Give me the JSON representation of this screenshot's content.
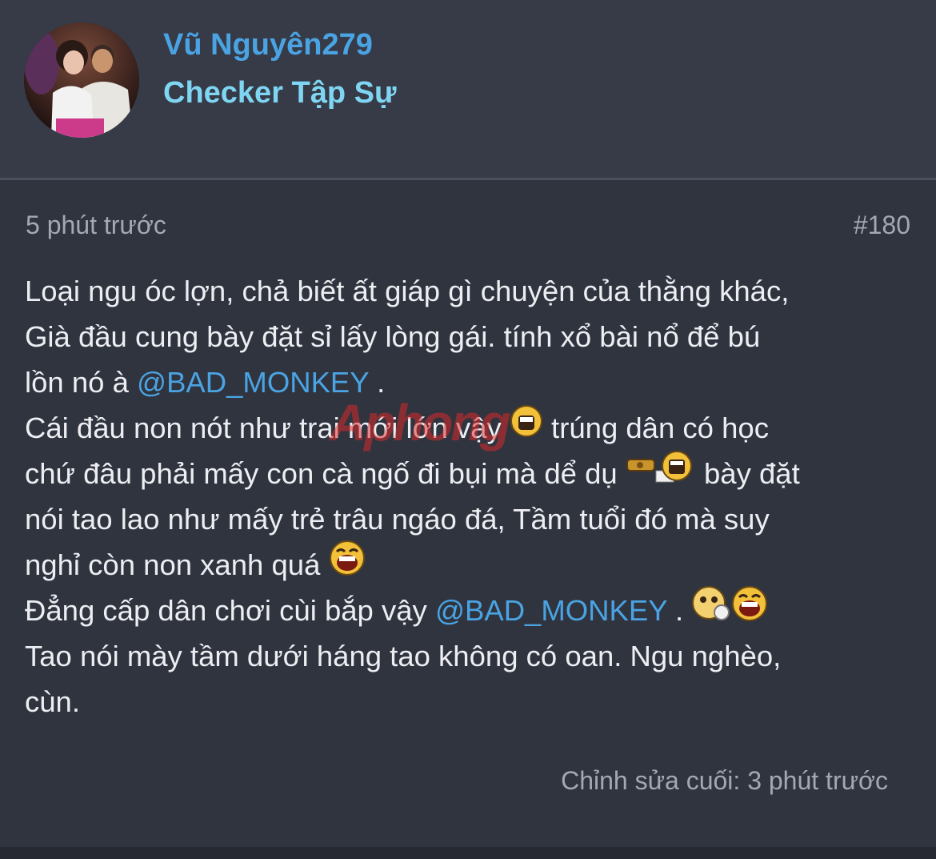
{
  "user": {
    "name": "Vũ Nguyên279",
    "title": "Checker Tập Sự"
  },
  "post": {
    "time": "5 phút trước",
    "number": "#180",
    "lines": [
      {
        "text": "Loại ngu óc lợn, chả biết ất giáp gì chuyện của thằng khác,"
      },
      {
        "text": "Già đầu cung bày đặt sỉ lấy lòng gái. tính xổ bài nổ để bú"
      },
      {
        "before": "lồn nó à ",
        "mention": "@BAD_MONKEY",
        "after": " ."
      },
      {
        "before": "Cái đầu non nót như trai mới lớn vậy ",
        "after": " trúng dân có học"
      },
      {
        "before": "chứ đâu phải mấy con cà ngố đi bụi mà dể dụ ",
        "after": " bày đặt"
      },
      {
        "text": "nói tao lao như mấy trẻ trâu ngáo đá, Tầm tuổi đó mà suy"
      },
      {
        "before": "nghỉ còn non xanh quá "
      },
      {
        "before": "Đẳng cấp dân chơi cùi bắp vậy ",
        "mention": "@BAD_MONKEY",
        "after": " . "
      },
      {
        "text": "Tao nói mày tầm dưới háng tao không có oan. Ngu nghèo,"
      },
      {
        "text": "cùn."
      }
    ],
    "edited": "Chỉnh sửa cuối: 3 phút trước"
  },
  "icons": {
    "laugh": "laughing-emoji-icon",
    "shy": "shy-emoji-icon",
    "gift": "gift-emoji-icon"
  },
  "watermark": "Aphong",
  "colors": {
    "background": "#30343f",
    "header": "#363b47",
    "name": "#4aa3e3",
    "title": "#7fd6f2",
    "text": "#eceef2",
    "muted": "#a4a8b1",
    "mention": "#4aa3e3"
  }
}
